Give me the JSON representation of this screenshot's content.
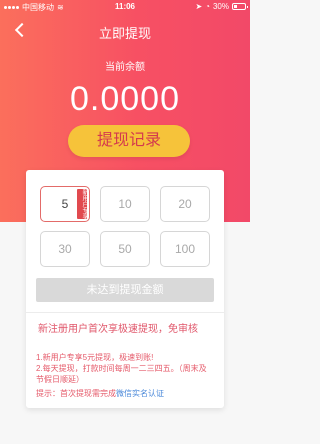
{
  "status_bar": {
    "carrier": "中国移动",
    "time": "11:06",
    "battery": "30%"
  },
  "nav": {
    "title": "立即提现"
  },
  "balance": {
    "label": "当前余额",
    "amount": "0.0000"
  },
  "history_button": "提现记录",
  "options": [
    {
      "value": "5",
      "selected": true,
      "badge": "新用户专享"
    },
    {
      "value": "10",
      "selected": false
    },
    {
      "value": "20",
      "selected": false
    },
    {
      "value": "30",
      "selected": false
    },
    {
      "value": "50",
      "selected": false
    },
    {
      "value": "100",
      "selected": false
    }
  ],
  "submit_label": "未达到提现金额",
  "new_user_note": "新注册用户首次享极速提现，免审核",
  "rules": {
    "line1": "1.新用户专享5元提现，极速到账!",
    "line2": "2.每天提现，打款时间每周一二三四五。（周末及节假日顺延）"
  },
  "tip": {
    "prefix": "提示：首次提现需完成",
    "link": "微信实名认证"
  },
  "colors": {
    "hero_start": "#fb6f5c",
    "hero_end": "#f24968",
    "history_button_bg": "#f6c33a",
    "accent_red": "#e14a4f",
    "link_blue": "#4a88d9"
  }
}
